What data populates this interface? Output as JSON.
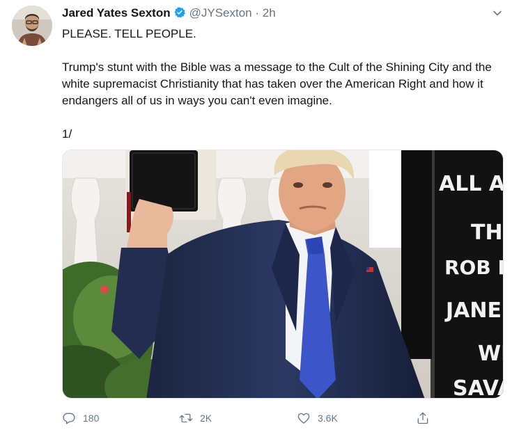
{
  "tweet": {
    "author_name": "Jared Yates Sexton",
    "handle": "@JYSexton",
    "separator": "·",
    "time": "2h",
    "text_lines": [
      "PLEASE. TELL PEOPLE.",
      "Trump's stunt with the Bible was a message to the Cult of the Shining City and the white supremacist Christianity that has taken over the American Right and how it endangers all of us in ways you can't even imagine.",
      "1/"
    ],
    "sign_text": [
      "ALL A",
      "THE",
      "ROB F",
      "JANE",
      "WIL",
      "SAVA"
    ]
  },
  "actions": {
    "replies": "180",
    "retweets": "2K",
    "likes": "3.6K"
  },
  "colors": {
    "accent": "#1da1f2",
    "muted": "#657786",
    "text": "#14171a"
  },
  "icons": [
    "verified-badge-icon",
    "chevron-down-icon",
    "reply-icon",
    "retweet-icon",
    "like-icon",
    "share-icon"
  ]
}
